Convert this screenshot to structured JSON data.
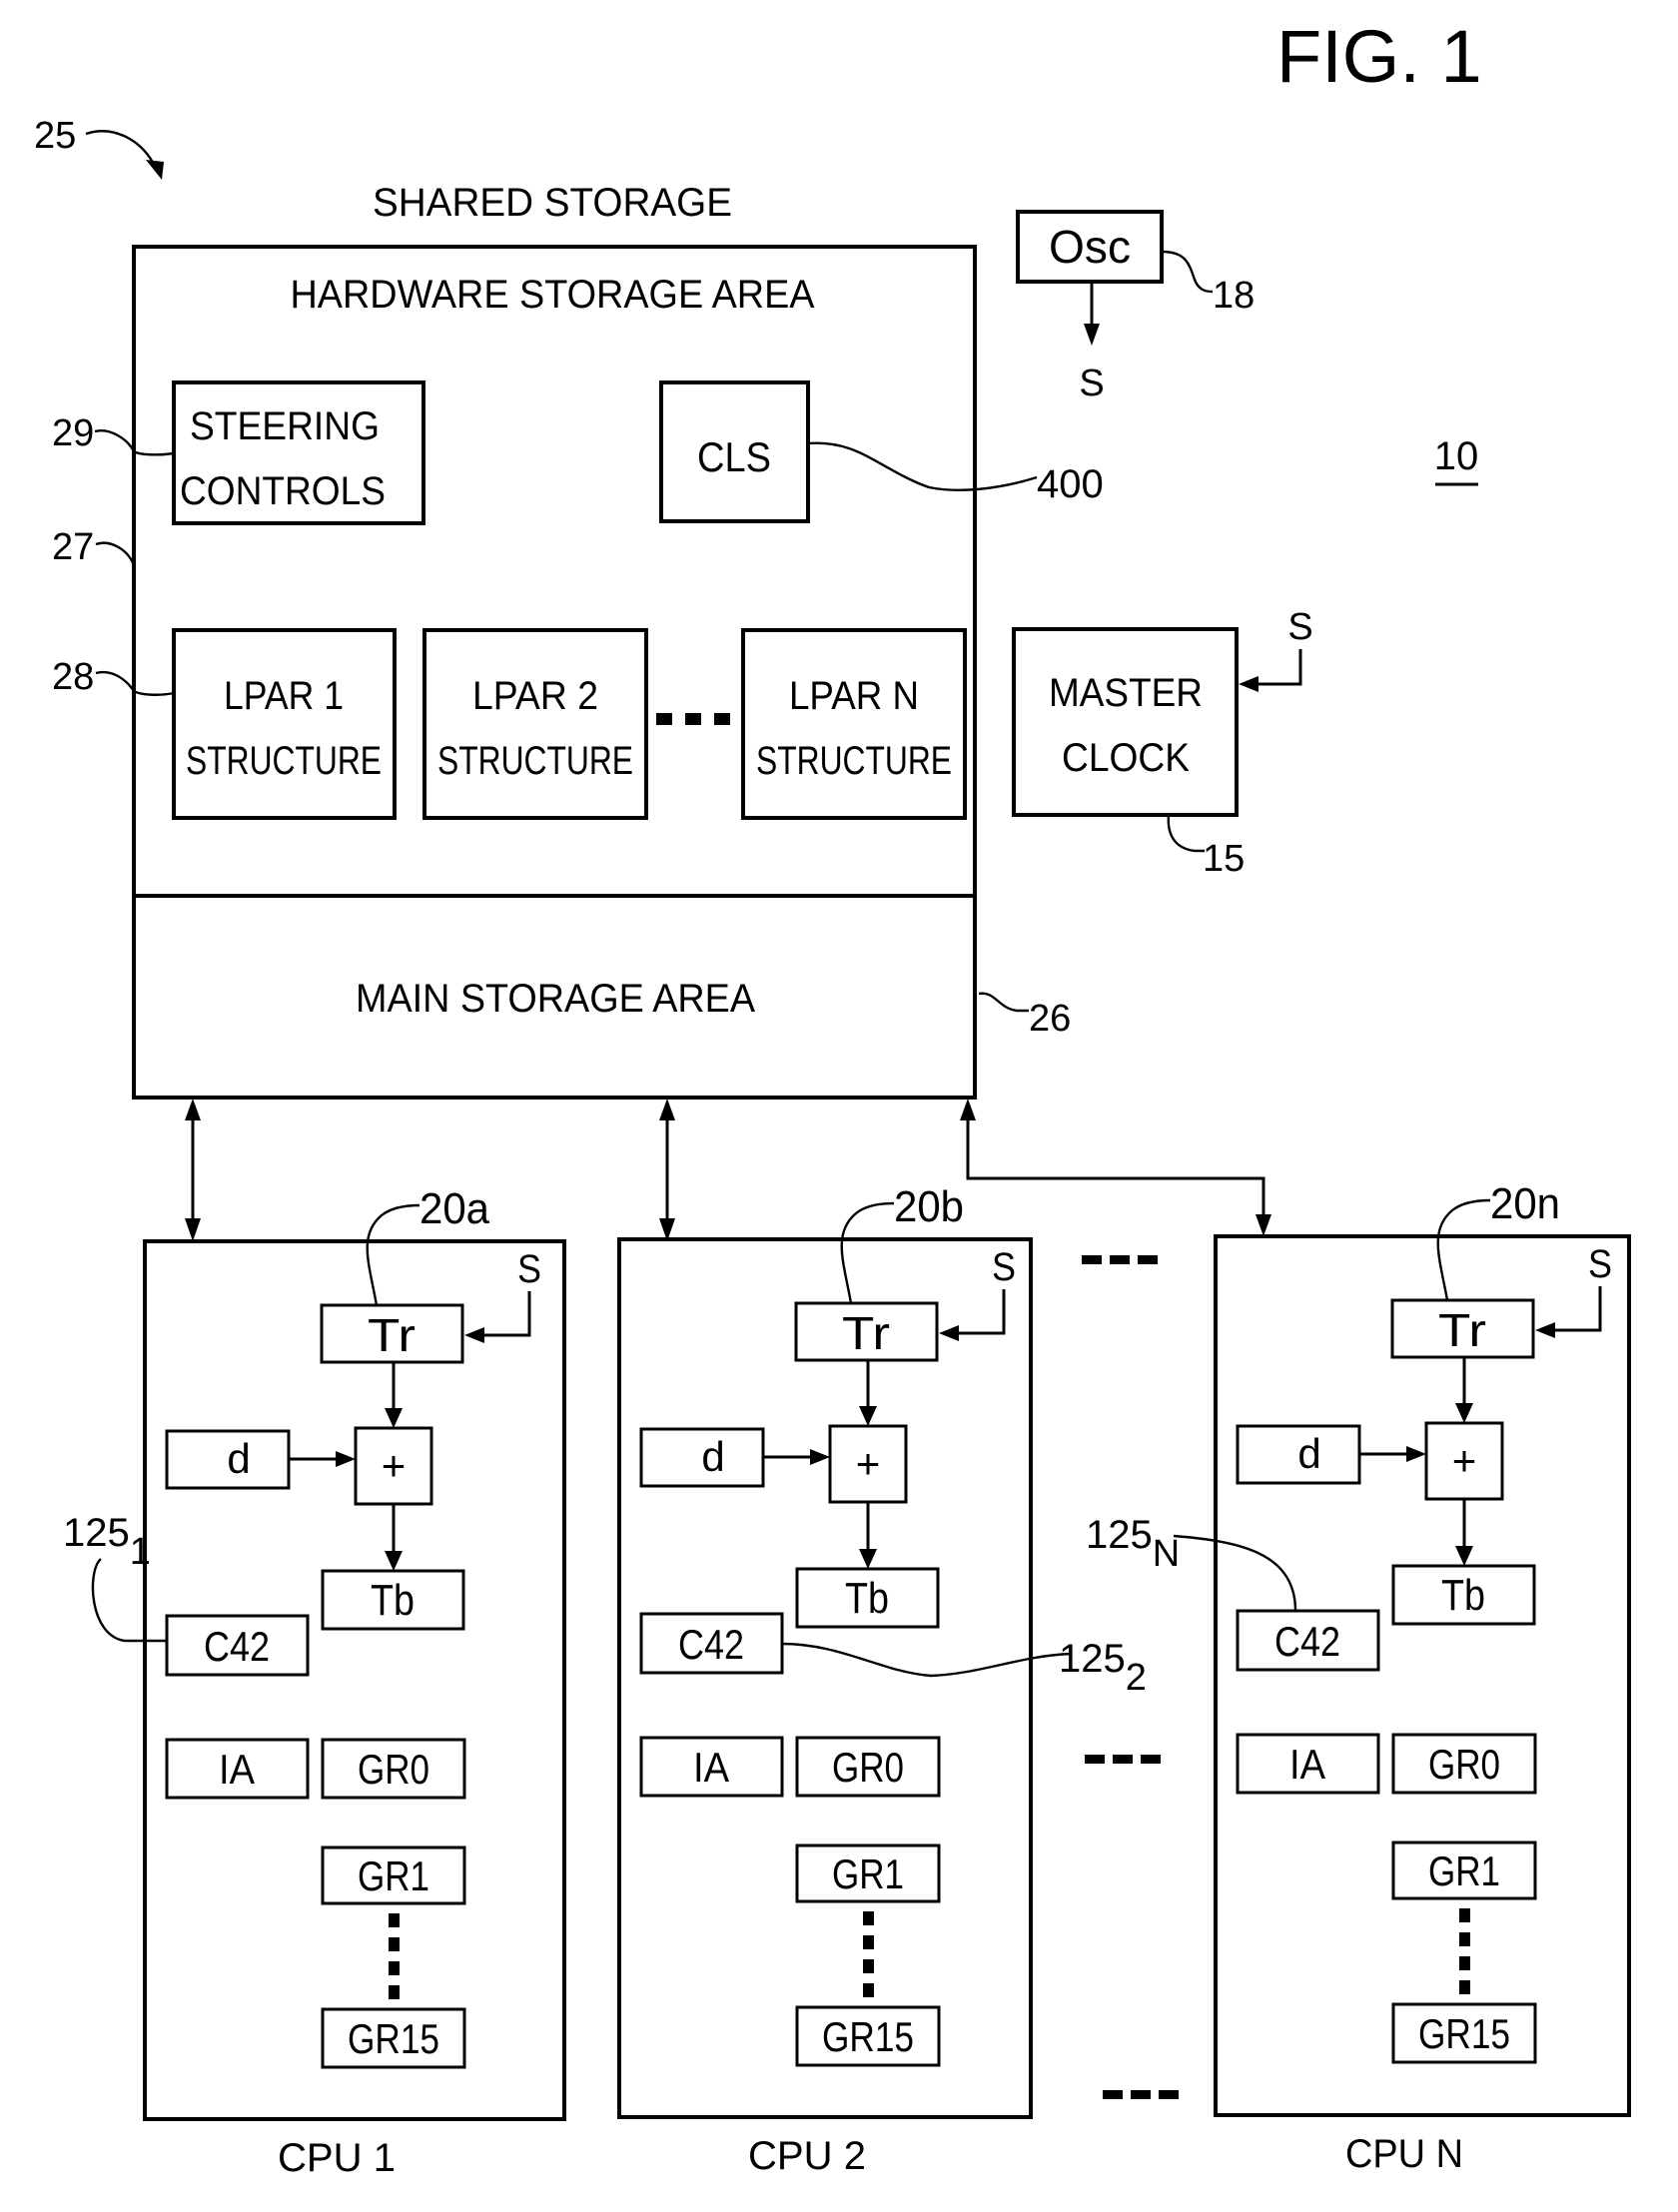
{
  "figure": {
    "title": "FIG. 1",
    "system_ref": "10",
    "overall_ref": "25"
  },
  "shared_storage": {
    "heading": "SHARED  STORAGE",
    "hardware_area_label": "HARDWARE STORAGE AREA",
    "hardware_ref": "27",
    "main_area_label": "MAIN STORAGE AREA",
    "main_ref": "26",
    "steering": {
      "line1": "STEERING",
      "line2": "CONTROLS",
      "ref": "29"
    },
    "cls": {
      "label": "CLS",
      "ref": "400"
    },
    "lpar_ref": "28",
    "lpars": [
      {
        "line1": "LPAR 1",
        "line2": "STRUCTURE"
      },
      {
        "line1": "LPAR 2",
        "line2": "STRUCTURE"
      },
      {
        "line1": "LPAR N",
        "line2": "STRUCTURE"
      }
    ],
    "lpar_ellipsis": "▪▪▪"
  },
  "oscillator": {
    "label": "Osc",
    "ref": "18",
    "signal": "S"
  },
  "master_clock": {
    "line1": "MASTER",
    "line2": "CLOCK",
    "ref": "15",
    "signal": "S"
  },
  "cpus": [
    {
      "name": "CPU  1",
      "ref": "20a",
      "signal": "S",
      "tr": "Tr",
      "d": "d",
      "adder": "+",
      "tb": "Tb",
      "c42": "C42",
      "c42_ref": "125",
      "c42_ref_sub": "1",
      "ia": "IA",
      "gr0": "GR0",
      "gr1": "GR1",
      "gr15": "GR15"
    },
    {
      "name": "CPU  2",
      "ref": "20b",
      "signal": "S",
      "tr": "Tr",
      "d": "d",
      "adder": "+",
      "tb": "Tb",
      "c42": "C42",
      "c42_ref": "125",
      "c42_ref_sub": "2",
      "ia": "IA",
      "gr0": "GR0",
      "gr1": "GR1",
      "gr15": "GR15"
    },
    {
      "name": "CPU  N",
      "ref": "20n",
      "signal": "S",
      "tr": "Tr",
      "d": "d",
      "adder": "+",
      "tb": "Tb",
      "c42": "C42",
      "c42_ref": "125",
      "c42_ref_sub": "N",
      "ia": "IA",
      "gr0": "GR0",
      "gr1": "GR1",
      "gr15": "GR15"
    }
  ]
}
